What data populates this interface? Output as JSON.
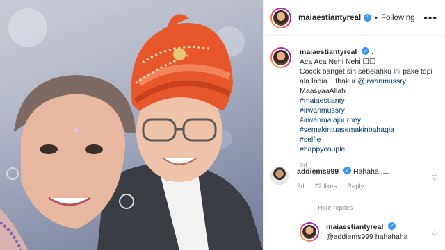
{
  "post": {
    "username": "maiaestiantyreal",
    "follow_label": "Following",
    "dot": "•",
    "more": "•••"
  },
  "caption": {
    "username": "maiaestiantyreal",
    "suffix": ".",
    "line1": "Aca Aca Nehi Nehi ☐☐",
    "line2": "Cocok banget sih sebelahku ini pake topi ala India... thakur ",
    "mention": "@irwanmussry",
    "line2_end": " ..",
    "line3": "MaasyaaAllah",
    "hashtags": [
      "#maiaestianty",
      "#irwanmussry",
      "#irwanmaiajourney",
      "#semakintuasemakinbahagia",
      "#selfie",
      "#happycouple"
    ],
    "time": "2d"
  },
  "comment": {
    "username": "addiems999",
    "text": "Hahaha.....",
    "time": "2d",
    "likes": "22 likes",
    "reply": "Reply",
    "hide_replies": "Hide replies"
  },
  "reply": {
    "username": "maiaestiantyreal",
    "text": "@addiems999 hahahaha"
  },
  "colors": {
    "accent_blue": "#3897f0",
    "link": "#00376b",
    "muted": "#8e8e8e",
    "turban": "#e8572c"
  }
}
